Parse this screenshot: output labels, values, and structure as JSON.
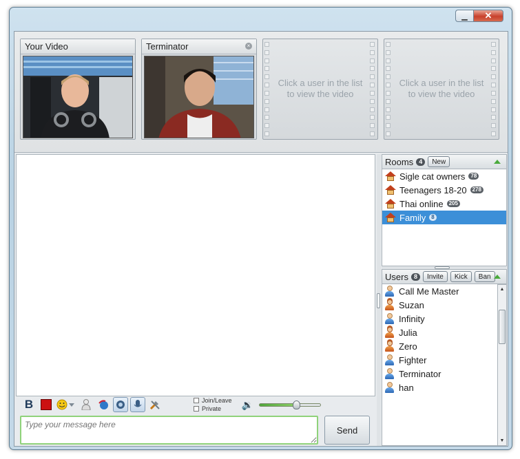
{
  "window": {
    "close_glyph": "✕",
    "min_glyph": "▁"
  },
  "videos": [
    {
      "title": "Your Video",
      "closable": false
    },
    {
      "title": "Terminator",
      "closable": true
    }
  ],
  "empty_video_hint": {
    "line1": "Click a user in the list",
    "line2": "to view the video"
  },
  "toolbar": {
    "bold_label": "B",
    "join_leave_label": "Join/Leave",
    "private_label": "Private",
    "volume_level": 0.6
  },
  "message": {
    "placeholder": "Type your message here",
    "send_label": "Send"
  },
  "rooms": {
    "title": "Rooms",
    "count": "4",
    "new_label": "New",
    "items": [
      {
        "name": "Sigle cat owners",
        "count": "78"
      },
      {
        "name": "Teenagers 18-20",
        "count": "278"
      },
      {
        "name": "Thai online",
        "count": "205"
      },
      {
        "name": "Family",
        "count": "8",
        "selected": true
      }
    ]
  },
  "users": {
    "title": "Users",
    "count": "8",
    "invite_label": "Invite",
    "kick_label": "Kick",
    "ban_label": "Ban",
    "items": [
      {
        "name": "Call Me Master",
        "gender": "male"
      },
      {
        "name": "Suzan",
        "gender": "female"
      },
      {
        "name": "Infinity",
        "gender": "male"
      },
      {
        "name": "Julia",
        "gender": "female"
      },
      {
        "name": "Zero",
        "gender": "female"
      },
      {
        "name": "Fighter",
        "gender": "male"
      },
      {
        "name": "Terminator",
        "gender": "male"
      },
      {
        "name": "han",
        "gender": "male"
      }
    ]
  },
  "colors": {
    "accent": "#3c8fd8",
    "input_border": "#8fd27a",
    "volume": "#4fa63a"
  }
}
